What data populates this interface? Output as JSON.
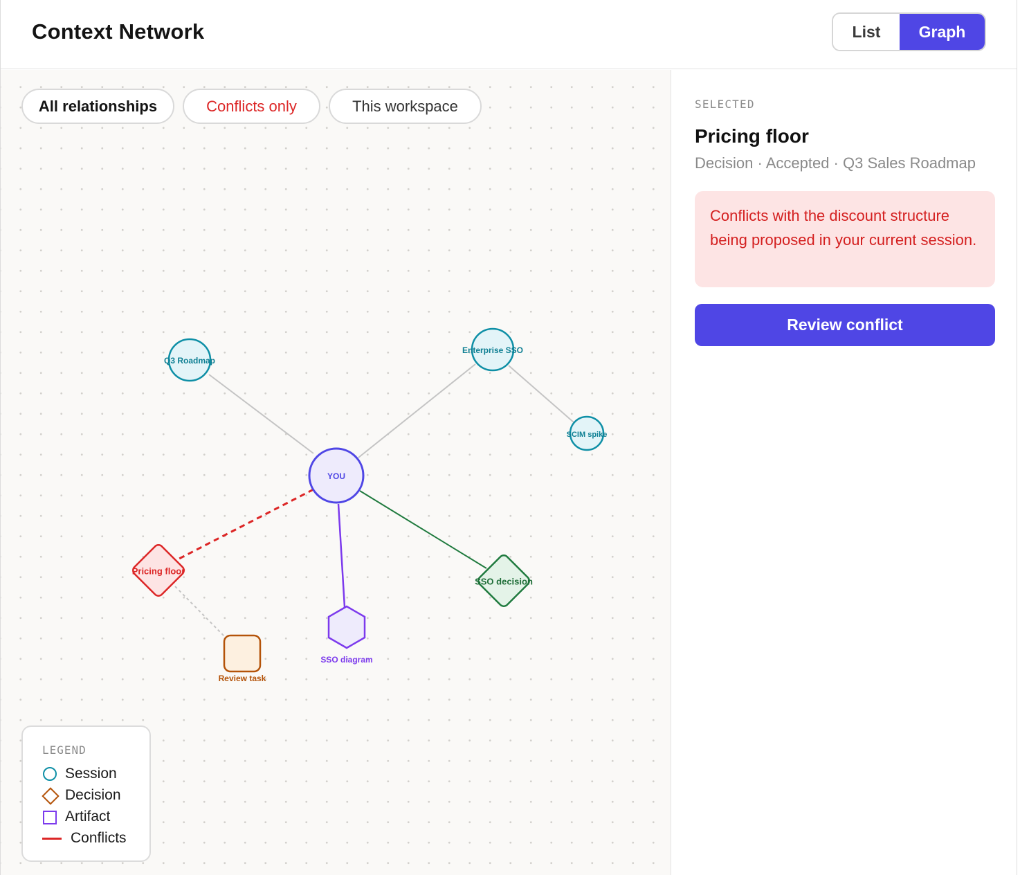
{
  "header": {
    "title": "Context Network",
    "view_toggle": {
      "list_label": "List",
      "graph_label": "Graph",
      "active": "Graph"
    }
  },
  "filters": {
    "all": "All relationships",
    "conflicts": "Conflicts only",
    "workspace": "This workspace"
  },
  "graph": {
    "center_label": "YOU",
    "nodes": {
      "q3_roadmap": {
        "label": "Q3 Roadmap",
        "type": "session"
      },
      "enterprise_sso": {
        "label": "Enterprise SSO",
        "type": "session"
      },
      "scim_spike": {
        "label": "SCIM spike",
        "type": "session"
      },
      "pricing_floor": {
        "label": "Pricing floor",
        "type": "decision",
        "status": "conflict"
      },
      "sso_decision": {
        "label": "SSO decision",
        "type": "decision"
      },
      "sso_diagram": {
        "label": "SSO diagram",
        "type": "artifact"
      },
      "review_task": {
        "label": "Review task",
        "type": "task"
      }
    },
    "colors": {
      "session": "#0e8fa6",
      "decision": "#b45309",
      "artifact": "#7c3aed",
      "conflict": "#dc2626",
      "you": "#4f46e5",
      "green": "#1f7a3e"
    }
  },
  "legend": {
    "title": "LEGEND",
    "items": [
      "Session",
      "Decision",
      "Artifact",
      "Conflicts"
    ]
  },
  "selected": {
    "label": "SELECTED",
    "title": "Pricing floor",
    "meta": "Decision · Accepted · Q3 Sales Roadmap",
    "conflict_message": "Conflicts with the discount structure being proposed in your current session.",
    "action_label": "Review conflict"
  }
}
